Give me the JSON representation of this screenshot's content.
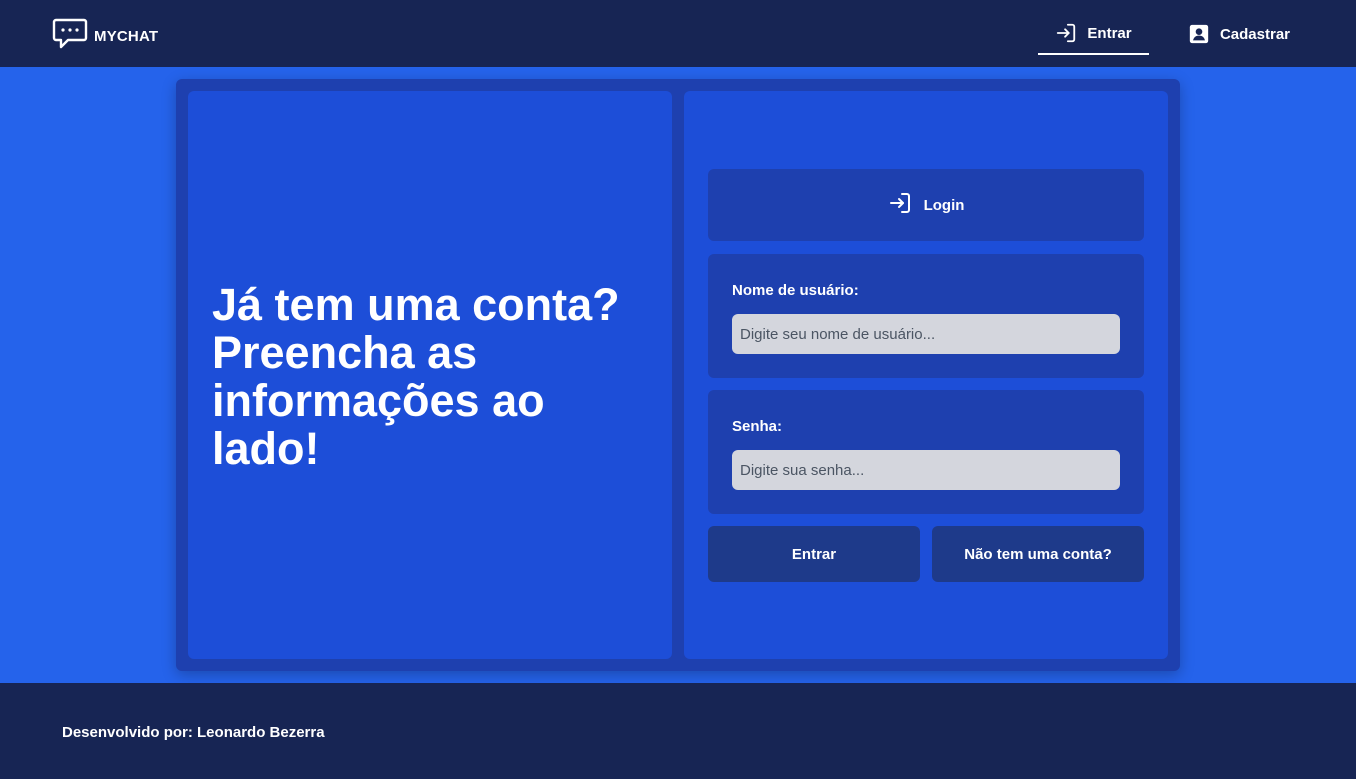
{
  "header": {
    "brand_name": "MYCHAT",
    "brand_icon": "chat-bubble-icon",
    "nav": {
      "login_label": "Entrar",
      "login_icon": "login-arrow-icon",
      "register_label": "Cadastrar",
      "register_icon": "user-card-icon"
    }
  },
  "hero": {
    "headline": "Já tem uma conta? Preencha as informações ao lado!"
  },
  "form": {
    "title": "Login",
    "title_icon": "login-arrow-icon",
    "username": {
      "label": "Nome de usuário:",
      "placeholder": "Digite seu nome de usuário...",
      "value": ""
    },
    "password": {
      "label": "Senha:",
      "placeholder": "Digite sua senha...",
      "value": ""
    },
    "submit_label": "Entrar",
    "signup_label": "Não tem uma conta?"
  },
  "footer": {
    "credit": "Desenvolvido por: Leonardo Bezerra"
  },
  "colors": {
    "page_bg": "#2563eb",
    "header_bg": "#172554",
    "card_bg": "#1e40af",
    "panel_bg": "#1d4ed8",
    "button_bg": "#1e3a8a",
    "input_bg": "#d4d6dd"
  }
}
